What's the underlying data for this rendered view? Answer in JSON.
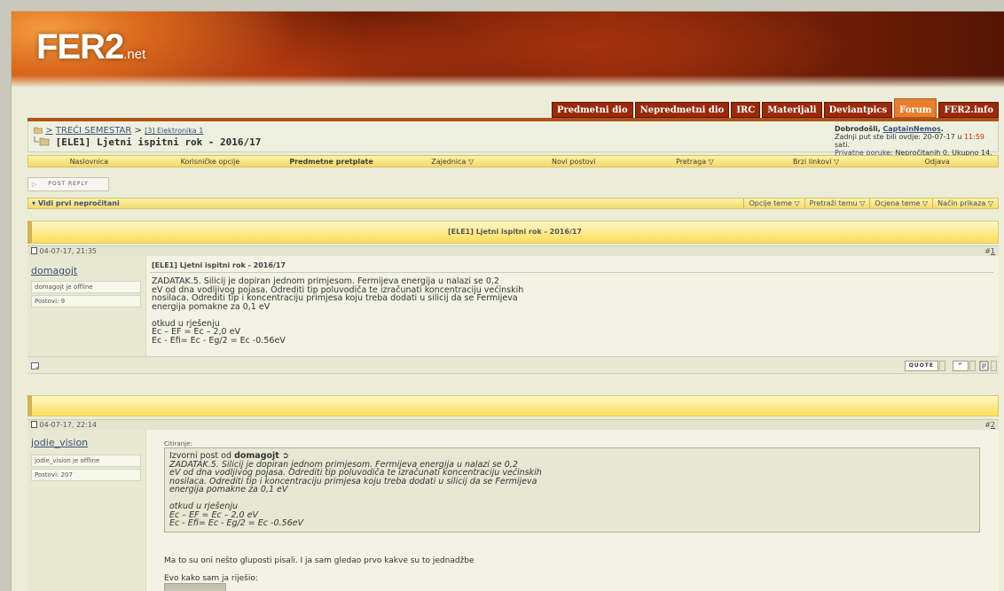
{
  "site": {
    "logo": "FER2",
    "logo_suffix": ".net"
  },
  "tabs": [
    {
      "label": "Predmetni dio",
      "active": false
    },
    {
      "label": "Nepredmetni dio",
      "active": false
    },
    {
      "label": "IRC",
      "active": false
    },
    {
      "label": "Materijali",
      "active": false
    },
    {
      "label": "Deviantpics",
      "active": false
    },
    {
      "label": "Forum",
      "active": true
    },
    {
      "label": "FER2.info",
      "active": false
    }
  ],
  "breadcrumb": {
    "prefix": ">",
    "level1": "TREĆI SEMESTAR",
    "sep": ">",
    "level2": "[3] Elektronika 1",
    "current": "[ELE1] Ljetni ispitni rok - 2016/17"
  },
  "welcome": {
    "greeting": "Dobrodošli,",
    "user": "CaptainNemos",
    "user_suffix": ".",
    "last_visit_label": "Zadnji put ste bili ovdje: 20-07-17 u",
    "last_visit_time": "11:59",
    "last_visit_suffix": "sati.",
    "pm_link": "Privatne poruke",
    "pm_text": ": Nepročitanih 0, Ukupno 14."
  },
  "menu": [
    {
      "label": "Naslovnica",
      "bold": false
    },
    {
      "label": "Korisničke opcije",
      "bold": false
    },
    {
      "label": "Predmetne pretplate",
      "bold": true
    },
    {
      "label": "Zajednica ▽",
      "bold": false
    },
    {
      "label": "Novi postovi",
      "bold": false
    },
    {
      "label": "Pretraga ▽",
      "bold": false
    },
    {
      "label": "Brzi linkovi ▽",
      "bold": false
    },
    {
      "label": "Odjava",
      "bold": false
    }
  ],
  "post_reply_label": "POST REPLY",
  "thread_bar": {
    "first_unread": "Vidi prvi nepročitani",
    "options": [
      "Opcije teme ▽",
      "Pretraži temu ▽",
      "Ocjena teme ▽",
      "Način prikaza ▽"
    ]
  },
  "thread_title": "[ELE1] Ljetni ispitni rok - 2016/17",
  "posts": [
    {
      "date": "04-07-17, 21:35",
      "num_prefix": "#",
      "num": "1",
      "username": "domagojt",
      "status": "domagojt je offline",
      "posts_count": "Postovi: 9",
      "title": "[ELE1] Ljetni ispitni rok - 2016/17",
      "body": "ZADATAK.5. Silicij je dopiran jednom primjesom. Fermijeva energija u nalazi se 0,2\neV od dna vodljivog pojasa. Odrediti tip poluvodiča te izračunati koncentraciju većinskih\nnosilaca. Odrediti tip i koncentraciju primjesa koju treba dodati u silicij da se Fermijeva\nenergija pomakne za 0,1 eV\n\notkud u rješenju\nEc – EF = Ec – 2,0 eV\nEc - Efi= Ec - Eg/2 = Ec -0.56eV",
      "quote_btn": "QUOTE"
    },
    {
      "date": "04-07-17, 22:14",
      "num_prefix": "#",
      "num": "2",
      "username": "jodie_vision",
      "status": "jodie_vision je offline",
      "posts_count": "Postovi: 207",
      "quote_label": "Citiranje:",
      "quote_head_prefix": "Izvorni post od",
      "quote_author": "domagojt",
      "quote_body": "ZADATAK.5. Silicij je dopiran jednom primjesom. Fermijeva energija u nalazi se 0,2\neV od dna vodljivog pojasa. Odrediti tip poluvodiča te izračunati koncentraciju većinskih\nnosilaca. Odrediti tip i koncentraciju primjesa koju treba dodati u silicij da se Fermijeva\nenergija pomakne za 0,1 eV\n\notkud u rješenju\nEc – EF = Ec – 2,0 eV\nEc - Efi= Ec - Eg/2 = Ec -0.56eV",
      "reply1": "Ma to su oni nešto gluposti pisali. I ja sam gledao prvo kakve su to jednadžbe",
      "reply2": "Evo kako sam ja riješio:"
    }
  ]
}
